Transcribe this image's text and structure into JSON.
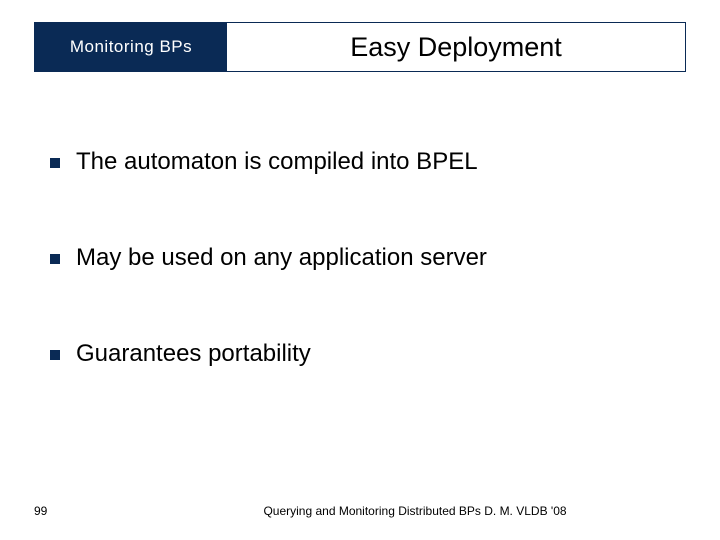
{
  "header": {
    "section": "Monitoring  BPs",
    "title": "Easy Deployment"
  },
  "bullets": [
    "The automaton is compiled into BPEL",
    "May be used on any application server",
    "Guarantees portability"
  ],
  "footer": {
    "page": "99",
    "text": "Querying and Monitoring Distributed BPs D. M. VLDB '08"
  }
}
